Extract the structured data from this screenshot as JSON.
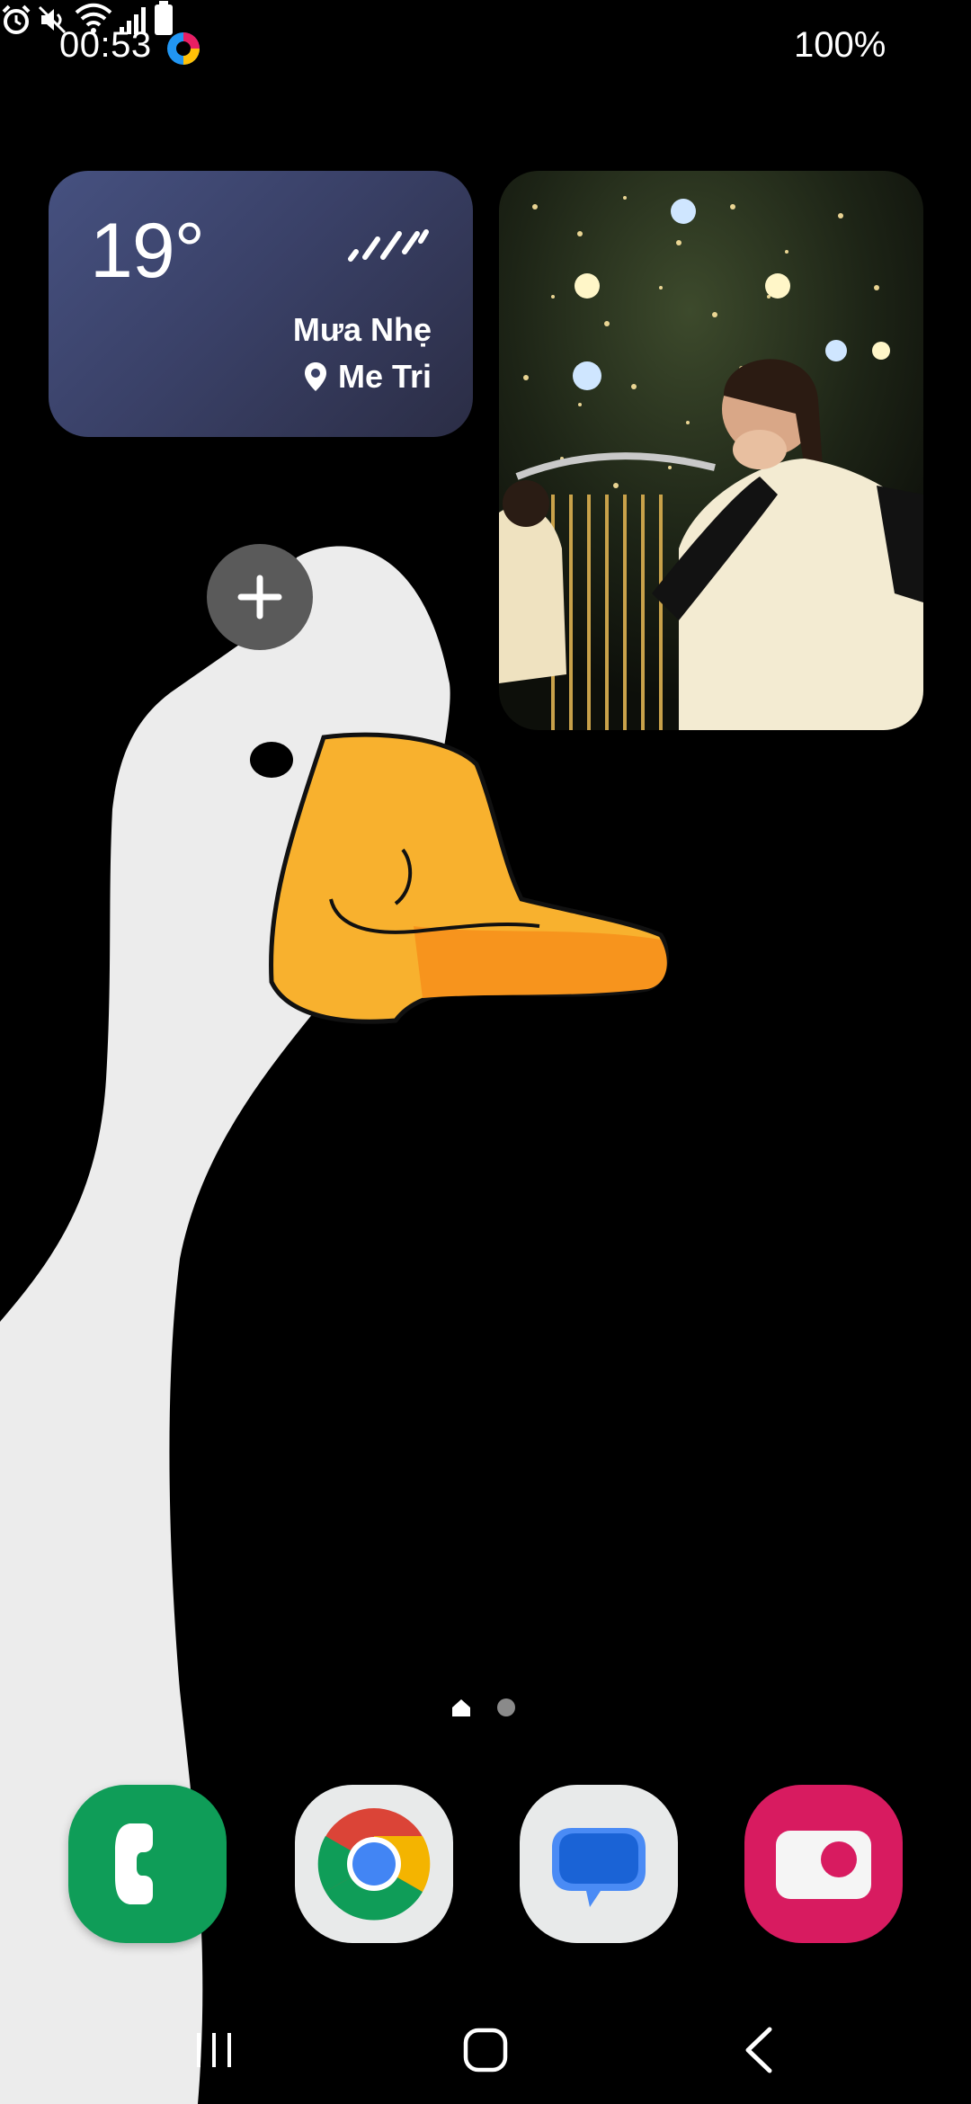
{
  "status_bar": {
    "time": "00:53",
    "battery": "100%",
    "icons": [
      "app-notification-icon",
      "alarm-icon",
      "mute-icon",
      "wifi-icon",
      "signal-icon",
      "battery-icon"
    ]
  },
  "weather_widget": {
    "temperature": "19°",
    "condition": "Mưa Nhẹ",
    "location": "Me Tri",
    "icons": [
      "rain-icon",
      "location-pin-icon"
    ]
  },
  "photo_widget": {
    "icon": "photo"
  },
  "add_widget": {
    "icon": "plus-icon"
  },
  "page_indicator": {
    "pages": 2,
    "current": 1,
    "icons": [
      "home-page-icon",
      "page-dot-icon"
    ]
  },
  "dock": {
    "apps": [
      {
        "name": "Phone",
        "icon": "phone-icon",
        "color": "#0F9D58"
      },
      {
        "name": "Chrome",
        "icon": "chrome-icon",
        "color": "#E8EAEA"
      },
      {
        "name": "Messages",
        "icon": "messages-icon",
        "color": "#E8EAEA"
      },
      {
        "name": "Camera",
        "icon": "camera-icon",
        "color": "#D81B60"
      }
    ]
  },
  "nav_bar": {
    "buttons": [
      "recents-icon",
      "home-icon",
      "back-icon"
    ]
  },
  "colors": {
    "background": "#000000",
    "weather_widget": "#3F4770",
    "add_button": "#5A5A5A",
    "goose_beak": "#F9B233",
    "goose_body": "#EDEDED"
  }
}
